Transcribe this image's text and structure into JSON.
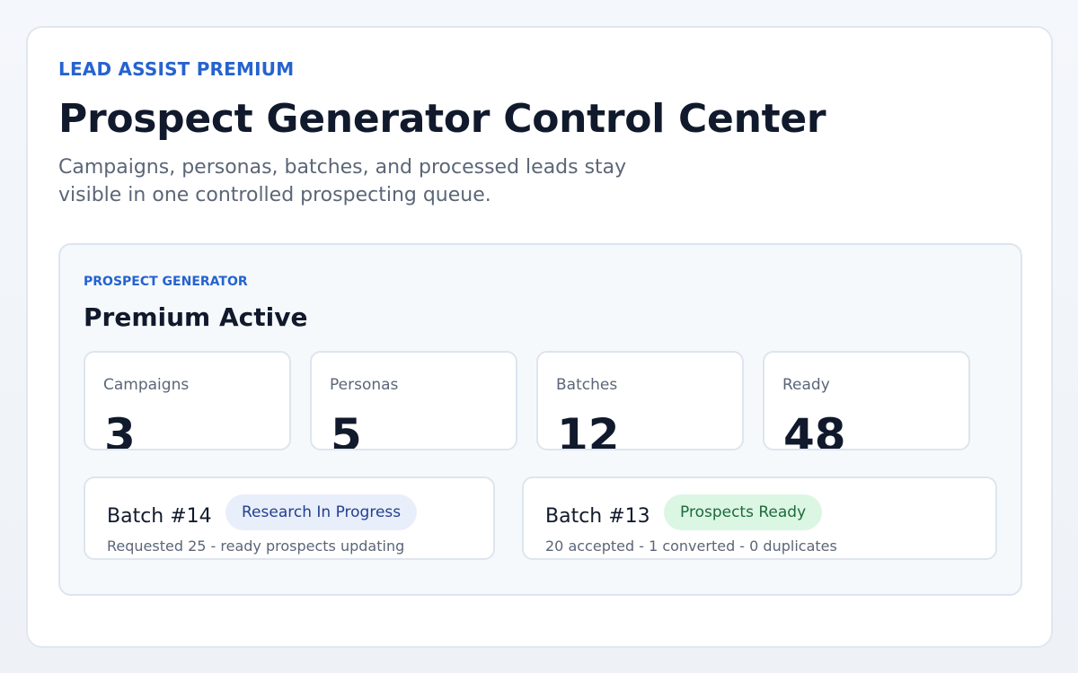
{
  "header": {
    "eyebrow": "LEAD ASSIST PREMIUM",
    "title": "Prospect Generator Control Center",
    "subtitle": "Campaigns, personas, batches, and processed leads stay visible in one controlled prospecting queue."
  },
  "panel": {
    "eyebrow": "PROSPECT GENERATOR",
    "title": "Premium Active",
    "stats": [
      {
        "label": "Campaigns",
        "value": "3"
      },
      {
        "label": "Personas",
        "value": "5"
      },
      {
        "label": "Batches",
        "value": "12"
      },
      {
        "label": "Ready",
        "value": "48"
      }
    ],
    "batches": [
      {
        "name": "Batch #14",
        "status": "Research In Progress",
        "meta": "Requested 25 - ready prospects updating"
      },
      {
        "name": "Batch #13",
        "status": "Prospects Ready",
        "meta": "20 accepted - 1 converted - 0 duplicates"
      }
    ]
  },
  "colors": {
    "accent": "#2563cf",
    "heading": "#111a2c",
    "muted": "#5b6677",
    "progress_badge_bg": "#e9eefb",
    "ready_badge_bg": "#dcf6e4"
  }
}
